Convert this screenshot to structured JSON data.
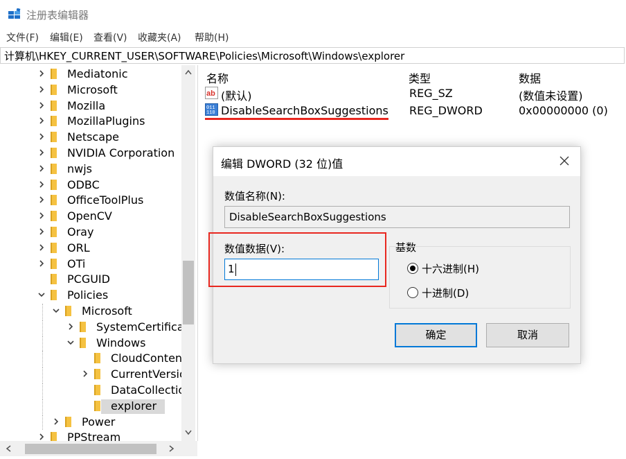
{
  "window": {
    "title": "注册表编辑器"
  },
  "menu": [
    "文件(F)",
    "编辑(E)",
    "查看(V)",
    "收藏夹(A)",
    "帮助(H)"
  ],
  "address": "计算机\\HKEY_CURRENT_USER\\SOFTWARE\\Policies\\Microsoft\\Windows\\explorer",
  "tree": [
    {
      "label": "Mediatonic",
      "level": 0,
      "expander": "collapsed"
    },
    {
      "label": "Microsoft",
      "level": 0,
      "expander": "collapsed"
    },
    {
      "label": "Mozilla",
      "level": 0,
      "expander": "collapsed"
    },
    {
      "label": "MozillaPlugins",
      "level": 0,
      "expander": "collapsed"
    },
    {
      "label": "Netscape",
      "level": 0,
      "expander": "collapsed"
    },
    {
      "label": "NVIDIA Corporation",
      "level": 0,
      "expander": "collapsed"
    },
    {
      "label": "nwjs",
      "level": 0,
      "expander": "collapsed"
    },
    {
      "label": "ODBC",
      "level": 0,
      "expander": "collapsed"
    },
    {
      "label": "OfficeToolPlus",
      "level": 0,
      "expander": "collapsed"
    },
    {
      "label": "OpenCV",
      "level": 0,
      "expander": "collapsed"
    },
    {
      "label": "Oray",
      "level": 0,
      "expander": "collapsed"
    },
    {
      "label": "ORL",
      "level": 0,
      "expander": "collapsed"
    },
    {
      "label": "OTi",
      "level": 0,
      "expander": "collapsed"
    },
    {
      "label": "PCGUID",
      "level": 0,
      "expander": "none"
    },
    {
      "label": "Policies",
      "level": 0,
      "expander": "expanded"
    },
    {
      "label": "Microsoft",
      "level": 1,
      "expander": "expanded"
    },
    {
      "label": "SystemCertificat",
      "level": 2,
      "expander": "collapsed"
    },
    {
      "label": "Windows",
      "level": 2,
      "expander": "expanded"
    },
    {
      "label": "CloudContent",
      "level": 3,
      "expander": "none"
    },
    {
      "label": "CurrentVersio",
      "level": 3,
      "expander": "collapsed"
    },
    {
      "label": "DataCollectio",
      "level": 3,
      "expander": "none"
    },
    {
      "label": "explorer",
      "level": 3,
      "expander": "none",
      "selected": true
    },
    {
      "label": "Power",
      "level": 1,
      "expander": "collapsed"
    },
    {
      "label": "PPStream",
      "level": 0,
      "expander": "collapsed"
    }
  ],
  "list": {
    "headers": {
      "name": "名称",
      "type": "类型",
      "data": "数据"
    },
    "rows": [
      {
        "name": "(默认)",
        "type": "REG_SZ",
        "data": "(数值未设置)",
        "icon": "ab-string-icon"
      },
      {
        "name": "DisableSearchBoxSuggestions",
        "type": "REG_DWORD",
        "data": "0x00000000 (0)",
        "icon": "binary-value-icon"
      }
    ]
  },
  "dialog": {
    "title": "编辑 DWORD (32 位)值",
    "name_label": "数值名称(N):",
    "name_value": "DisableSearchBoxSuggestions",
    "data_label": "数值数据(V):",
    "data_value": "1",
    "base_label": "基数",
    "hex_label": "十六进制(H)",
    "dec_label": "十进制(D)",
    "ok_label": "确定",
    "cancel_label": "取消"
  },
  "colors": {
    "highlight_red": "#e8271f",
    "accent_blue": "#0078d7",
    "folder": "#f5c242"
  }
}
